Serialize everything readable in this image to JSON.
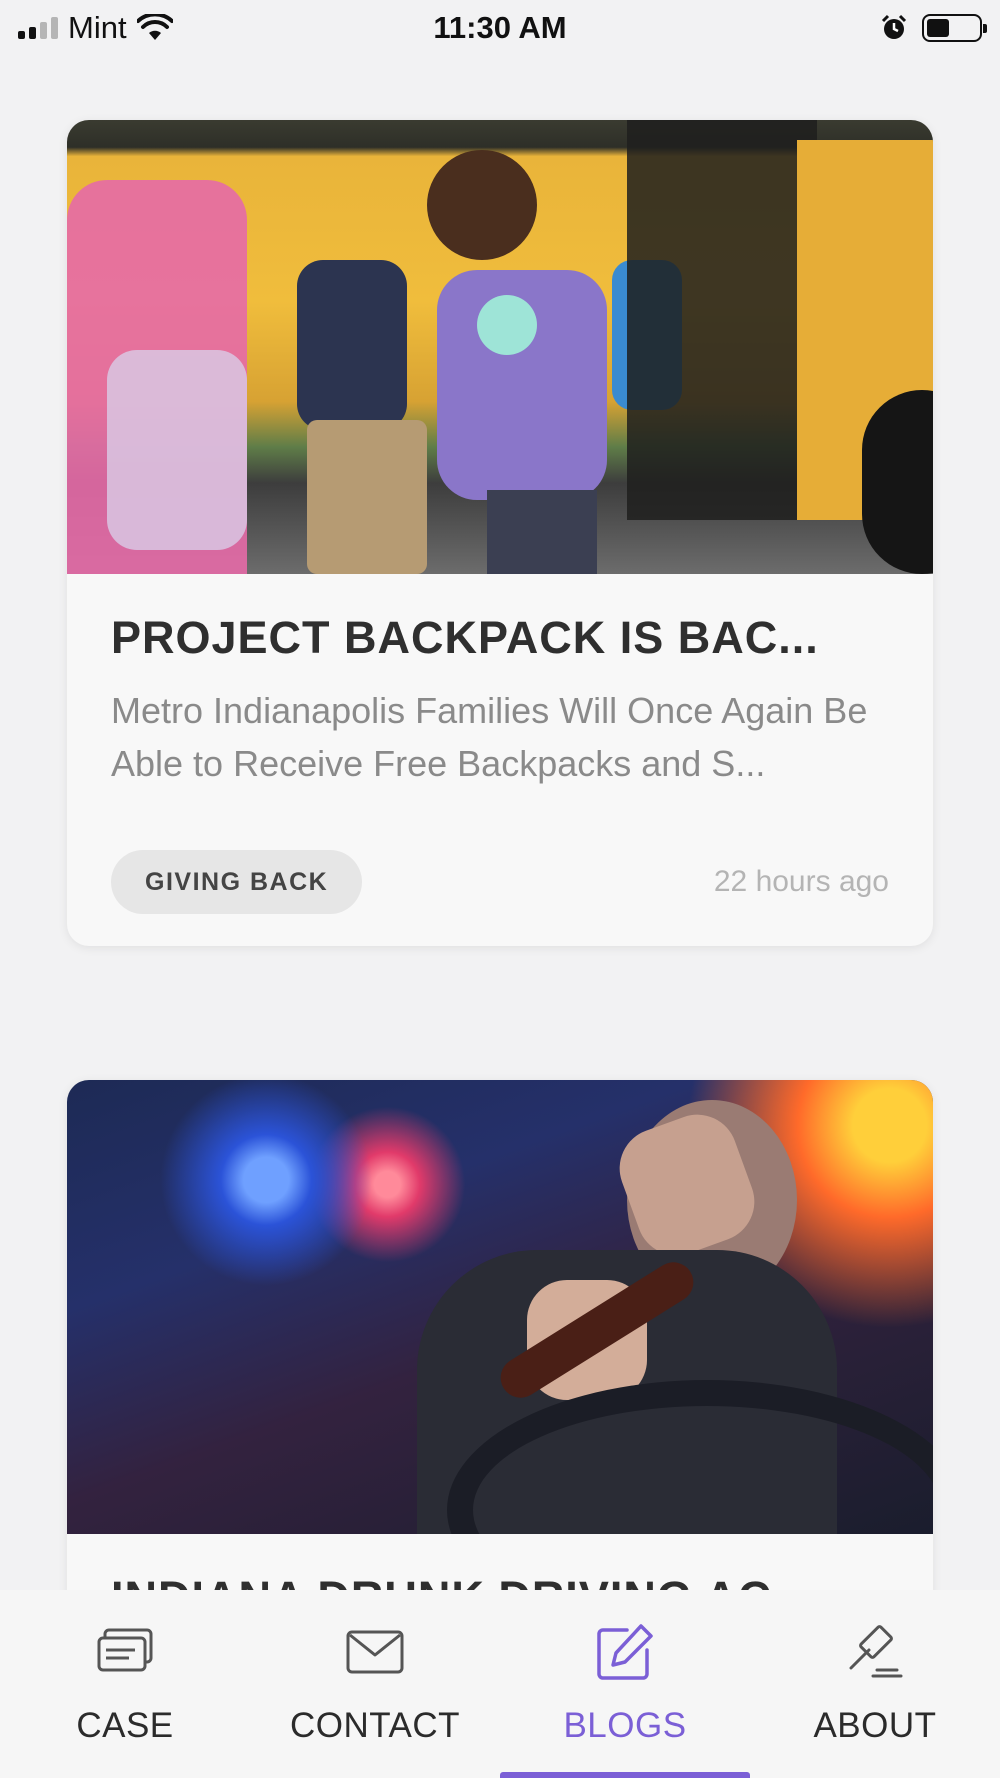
{
  "status_bar": {
    "carrier": "Mint",
    "time": "11:30 AM",
    "icons": [
      "signal-icon",
      "wifi-icon",
      "alarm-icon",
      "battery-icon"
    ]
  },
  "posts": [
    {
      "title": "PROJECT BACKPACK IS BAC...",
      "excerpt": "Metro Indianapolis Families Will Once Again Be Able to Receive Free Backpacks and S...",
      "tag": "GIVING BACK",
      "time_ago": "22 hours ago",
      "image": "children-boarding-school-bus-photo"
    },
    {
      "title": "INDIANA DRUNK DRIVING AC...",
      "image": "driver-with-bottle-police-lights-photo"
    }
  ],
  "tab_bar": {
    "items": [
      {
        "label": "CASE",
        "icon": "case-cards-icon"
      },
      {
        "label": "CONTACT",
        "icon": "envelope-icon"
      },
      {
        "label": "BLOGS",
        "icon": "edit-note-icon",
        "active": true
      },
      {
        "label": "ABOUT",
        "icon": "gavel-icon"
      }
    ],
    "active_color": "#7B5FD6"
  }
}
